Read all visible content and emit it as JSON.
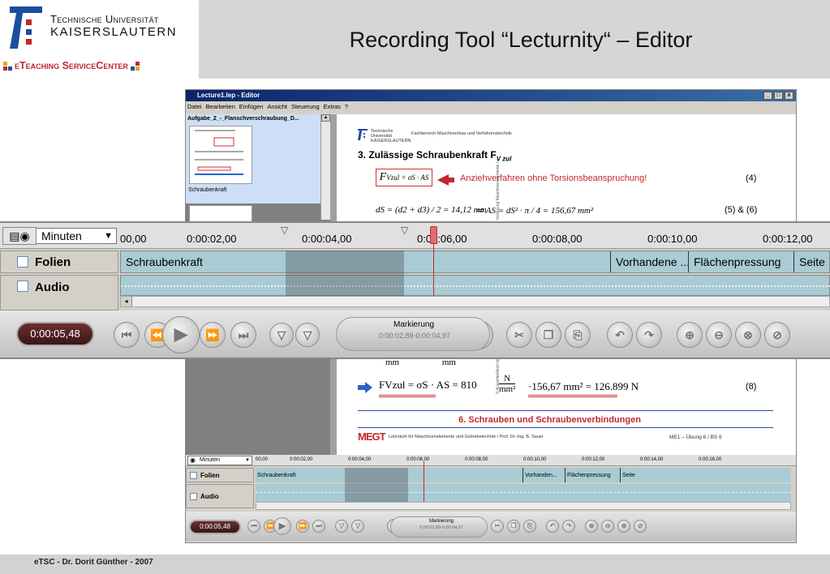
{
  "header": {
    "university_line1": "Technische Universität",
    "university_line2": "KAISERSLAUTERN",
    "etsc_label": "eTeaching ServiceCenter",
    "title": "Recording Tool “Lecturnity“ – Editor"
  },
  "editor_window": {
    "title": "Lecture1.lep - Editor",
    "menu": [
      "Datei",
      "Bearbeiten",
      "Einfügen",
      "Ansicht",
      "Steuerung",
      "Extras",
      "?"
    ],
    "window_buttons": [
      "_",
      "□",
      "x"
    ],
    "thumbnail_title": "Aufgabe_2_-_Flanschverschraubung_D...",
    "thumbnail_caption": "Schraubenkraft",
    "slide": {
      "uni": "Technische Universität KAISERSLAUTERN",
      "dept": "Fachbereich Maschinenbau und Verfahrenstechnik",
      "heading": "3.  Zulässige Schraubenkraft F",
      "heading_sub": "V zul",
      "formula_box": "F",
      "formula_box_rest": "Vzul = σS · AS",
      "note": "Anziehverfahren ohne Torsionsbeanspruchung!",
      "eq4": "(4)",
      "ds_formula": "dS = (d2 + d3) / 2 = 14,12 mm",
      "as_formula": "⇨   AS = dS² · π / 4 = 156,67 mm²",
      "eq56": "(5) & (6)",
      "mm_units": "mm mm",
      "f8_left": "FVzul = σS · AS = 810",
      "f8_frac_num": "N",
      "f8_frac_den": "mm²",
      "f8_right": "·156,67 mm² = 126.899 N",
      "eq8": "(8)",
      "section": "6. Schrauben und Schraubenverbindungen",
      "megt_logo": "MEGT",
      "megt_text": "Lehrstuhl für Maschinenelemente und Getriebetechnik / Prof. Dr.-Ing. B. Sauer",
      "megt_right": "ME1 – Übung 6 / BS 6",
      "side_text_top": "Vorlesung Maschinenelemente I",
      "side_text_bottom": "© Ausschließlich für Gebrauch"
    }
  },
  "timeline": {
    "unit_select": "Minuten",
    "ticks": [
      "00,00",
      "0:00:02,00",
      "0:00:04,00",
      "0:00:06,00",
      "0:00:08,00",
      "0:00:10,00",
      "0:00:12,00"
    ],
    "small_ticks": [
      "00,00",
      "0:00:02,00",
      "0:00:04,00",
      "0:00:06,00",
      "0:00:08,00",
      "0:00:10,00",
      "0:00:12,00",
      "0:00:14,00",
      "0:00:16,00"
    ],
    "lane_folien": "Folien",
    "lane_audio": "Audio",
    "segments": [
      "Schraubenkraft",
      "Vorhandene ...",
      "Flächenpressung",
      "Seite"
    ],
    "small_segments": [
      "Schraubenkraft",
      "Vorhanden...",
      "Flächenpressung",
      "Seite"
    ],
    "current_time": "0:00:05,48",
    "marking_label": "Markierung",
    "marking_range": "0:00:02,89-0:00:04,97"
  },
  "footer": {
    "text": "eTSC - Dr. Dorit Günther - 2007"
  }
}
